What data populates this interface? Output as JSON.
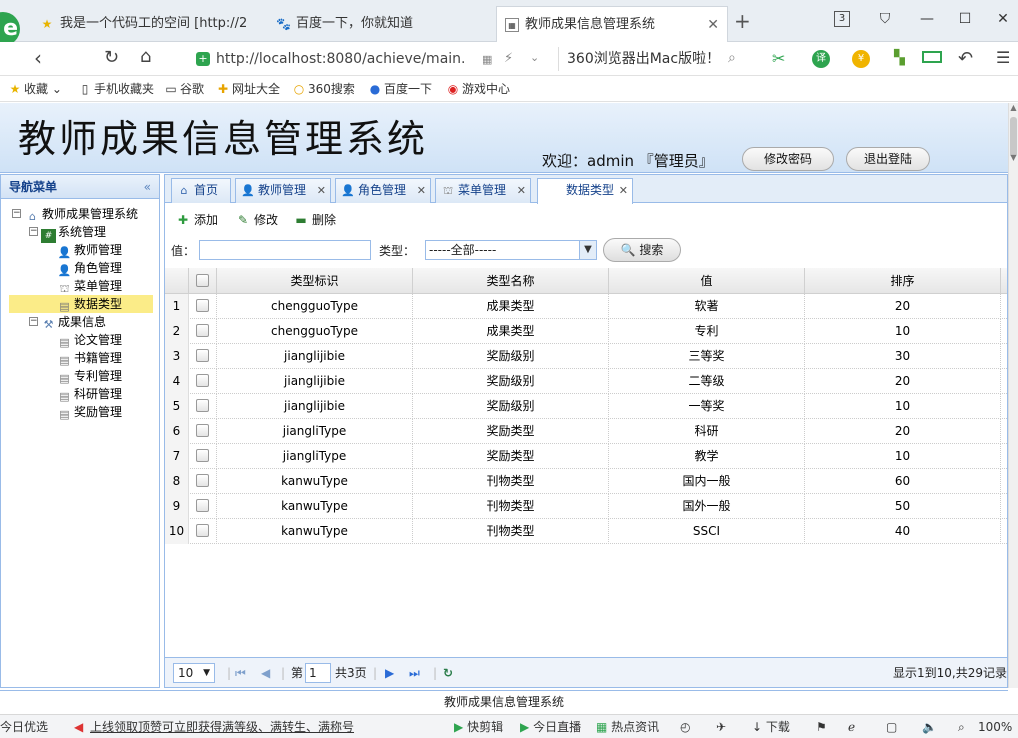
{
  "browser": {
    "tabs": [
      {
        "label": "我是一个代码工的空间 [http://2",
        "icon": "star-icon"
      },
      {
        "label": "百度一下，你就知道",
        "icon": "baidu-paw-icon"
      },
      {
        "label": "教师成果信息管理系统",
        "icon": "page-icon"
      }
    ],
    "tab_count": "3",
    "url": "http://localhost:8080/achieve/main.",
    "search_text": "360浏览器出Mac版啦！",
    "bookmarks": [
      "收藏",
      "手机收藏夹",
      "谷歌",
      "网址大全",
      "360搜索",
      "百度一下",
      "游戏中心"
    ]
  },
  "app": {
    "title": "教师成果信息管理系统",
    "welcome": "欢迎：admin 『管理员』",
    "change_password": "修改密码",
    "logout": "退出登陆",
    "footer_title": "教师成果信息管理系统"
  },
  "sidebar": {
    "header": "导航菜单",
    "collapse_glyph": "«",
    "root": "教师成果管理系统",
    "groups": [
      {
        "label": "系统管理",
        "items": [
          "教师管理",
          "角色管理",
          "菜单管理",
          "数据类型"
        ]
      },
      {
        "label": "成果信息",
        "items": [
          "论文管理",
          "书籍管理",
          "专利管理",
          "科研管理",
          "奖励管理"
        ]
      }
    ],
    "selected": "数据类型"
  },
  "page_tabs": [
    "首页",
    "教师管理",
    "角色管理",
    "菜单管理",
    "数据类型"
  ],
  "toolbar": {
    "add": "添加",
    "edit": "修改",
    "delete": "删除"
  },
  "filter": {
    "value_label": "值：",
    "type_label": "类型：",
    "type_selected": "-----全部-----",
    "search": "搜索"
  },
  "grid": {
    "columns": [
      "类型标识",
      "类型名称",
      "值",
      "排序"
    ],
    "rows": [
      [
        "1",
        "chengguoType",
        "成果类型",
        "软著",
        "20"
      ],
      [
        "2",
        "chengguoType",
        "成果类型",
        "专利",
        "10"
      ],
      [
        "3",
        "jianglijibie",
        "奖励级别",
        "三等奖",
        "30"
      ],
      [
        "4",
        "jianglijibie",
        "奖励级别",
        "二等级",
        "20"
      ],
      [
        "5",
        "jianglijibie",
        "奖励级别",
        "一等奖",
        "10"
      ],
      [
        "6",
        "jiangliType",
        "奖励类型",
        "科研",
        "20"
      ],
      [
        "7",
        "jiangliType",
        "奖励类型",
        "教学",
        "10"
      ],
      [
        "8",
        "kanwuType",
        "刊物类型",
        "国内一般",
        "60"
      ],
      [
        "9",
        "kanwuType",
        "刊物类型",
        "国外一般",
        "50"
      ],
      [
        "10",
        "kanwuType",
        "刊物类型",
        "SSCI",
        "40"
      ]
    ]
  },
  "pager": {
    "page_size": "10",
    "page_label": "第",
    "page": "1",
    "total_pages": "共3页",
    "summary": "显示1到10,共29记录"
  },
  "statusbar": {
    "left": "今日优选",
    "ticker": "上线领取顶赞可立即获得满等级、满转生、满称号",
    "items": [
      "快剪辑",
      "今日直播",
      "热点资讯",
      "下载"
    ],
    "zoom": "100%"
  }
}
